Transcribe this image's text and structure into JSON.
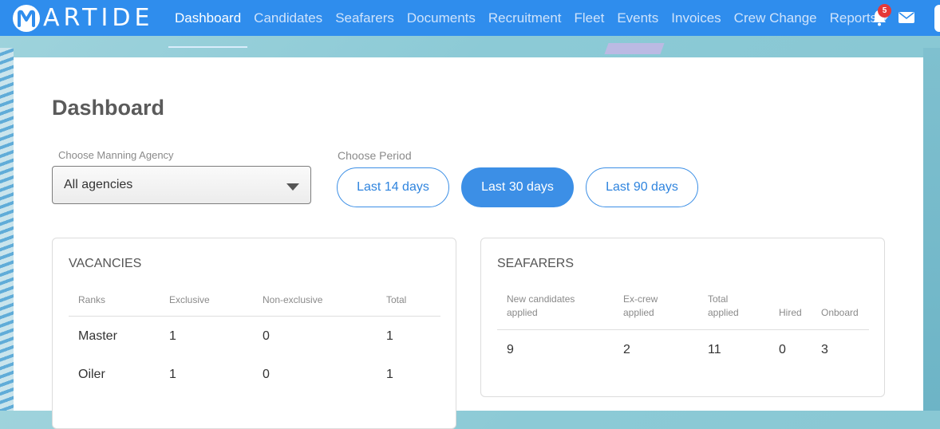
{
  "brand": {
    "name": "ARTIDE",
    "mark": "M"
  },
  "nav": {
    "items": [
      {
        "label": "Dashboard",
        "active": true
      },
      {
        "label": "Candidates"
      },
      {
        "label": "Seafarers"
      },
      {
        "label": "Documents"
      },
      {
        "label": "Recruitment"
      },
      {
        "label": "Fleet"
      },
      {
        "label": "Events"
      },
      {
        "label": "Invoices"
      },
      {
        "label": "Crew Change"
      },
      {
        "label": "Reports",
        "dropdown": true
      }
    ],
    "notifications_count": "5",
    "icons": [
      "bell-icon",
      "envelope-icon"
    ]
  },
  "page": {
    "title": "Dashboard"
  },
  "filters": {
    "agency_label": "Choose Manning Agency",
    "agency_value": "All agencies",
    "period_label": "Choose Period",
    "periods": [
      {
        "label": "Last 14 days",
        "active": false
      },
      {
        "label": "Last 30 days",
        "active": true
      },
      {
        "label": "Last 90 days",
        "active": false
      }
    ]
  },
  "vacancies": {
    "title": "VACANCIES",
    "headers": [
      "Ranks",
      "Exclusive",
      "Non-exclusive",
      "Total"
    ],
    "rows": [
      [
        "Master",
        "1",
        "0",
        "1"
      ],
      [
        "Oiler",
        "1",
        "0",
        "1"
      ]
    ]
  },
  "seafarers": {
    "title": "SEAFARERS",
    "headers": [
      [
        "New candidates",
        "applied"
      ],
      [
        "Ex-crew",
        "applied"
      ],
      [
        "Total",
        "applied"
      ],
      [
        "Hired"
      ],
      [
        "Onboard"
      ]
    ],
    "values": [
      "9",
      "2",
      "11",
      "0",
      "3"
    ]
  },
  "colors": {
    "primary": "#2f8ded",
    "accent": "#3c8fe6",
    "badge": "#e53939"
  }
}
